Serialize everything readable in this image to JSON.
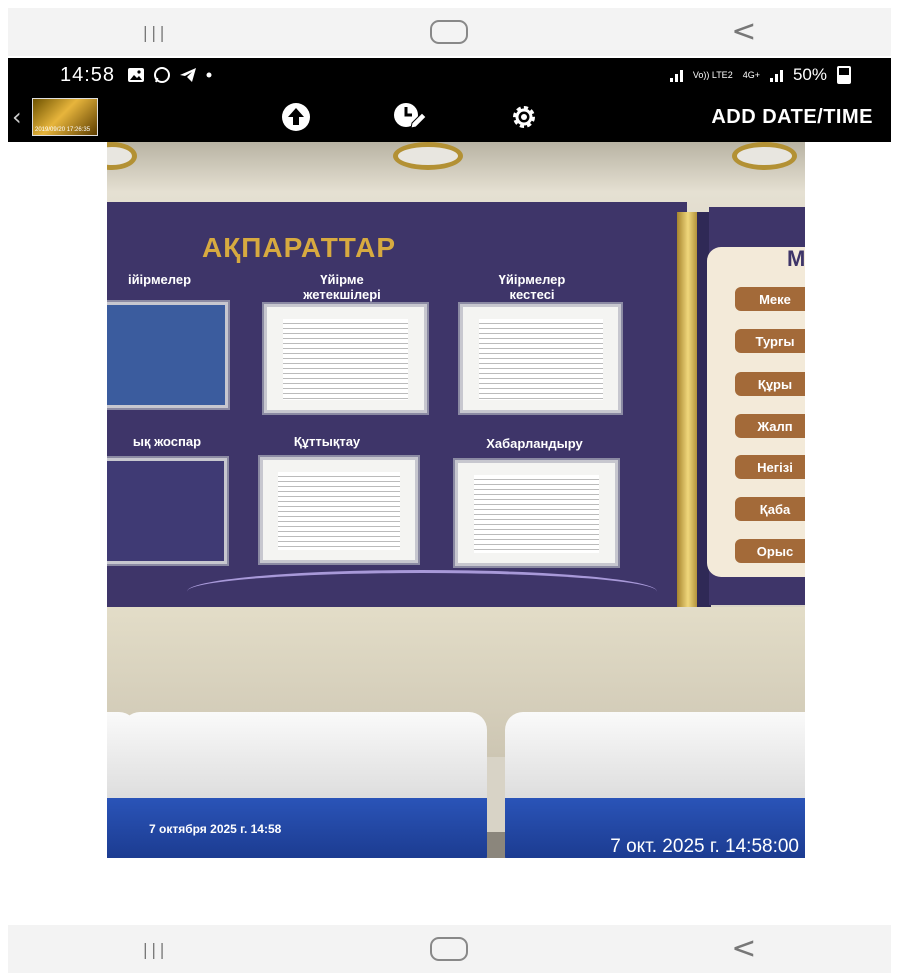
{
  "status_bar": {
    "time": "14:58",
    "notification_icons": [
      "gallery-icon",
      "whatsapp-icon",
      "telegram-icon",
      "dot-icon"
    ],
    "network_label": "Vo)) LTE2",
    "network_type": "4G+",
    "battery": "50%"
  },
  "toolbar": {
    "thumbnail_text": "2019/09/20 17:26:35",
    "icons": [
      "upload-icon",
      "timer-edit-icon",
      "settings-gear-icon"
    ],
    "add_date_time_label": "ADD DATE/TIME"
  },
  "photo": {
    "board_title": "АҚПАРАТТАР",
    "top_labels": [
      "ійірмелер",
      "Үйірме жетекшілері",
      "Үйірмелер кестесі"
    ],
    "bottom_labels": [
      "ық жоспар",
      "Құттықтау",
      "Хабарландыру"
    ],
    "menu_header": "М",
    "menu_buttons": [
      "Меке",
      "Тургы",
      "Құры",
      "Жалп",
      "Негізі",
      "Қаба",
      "Орыс"
    ],
    "stamp_small": "7 октября 2025 г. 14:58",
    "stamp_large": "7 окт. 2025 г. 14:58:00"
  },
  "colors": {
    "board": "#3e3569",
    "gold": "#d7aa40",
    "menu_button": "#a36a39",
    "chair_blue": "#1b3a8e"
  }
}
